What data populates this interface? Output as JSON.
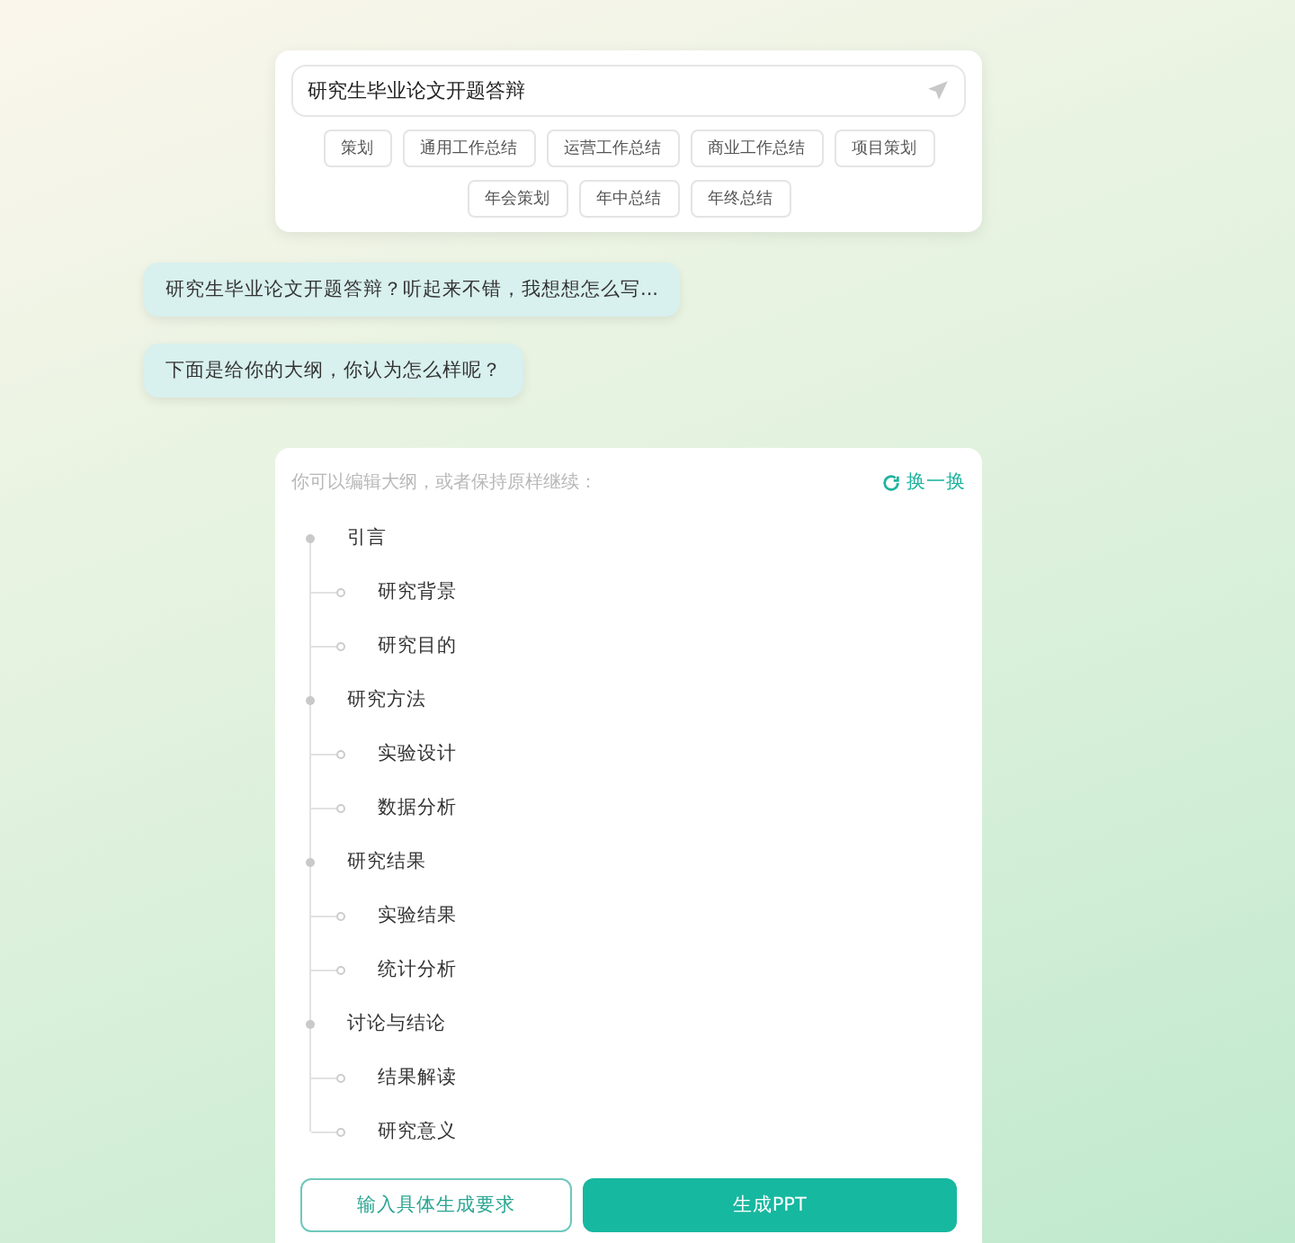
{
  "search": {
    "value": "研究生毕业论文开题答辩"
  },
  "chips": [
    [
      "策划",
      "通用工作总结",
      "运营工作总结",
      "商业工作总结",
      "项目策划"
    ],
    [
      "年会策划",
      "年中总结",
      "年终总结"
    ]
  ],
  "messages": [
    "研究生毕业论文开题答辩？听起来不错，我想想怎么写...",
    "下面是给你的大纲，你认为怎么样呢？"
  ],
  "outline": {
    "hint": "你可以编辑大纲，或者保持原样继续：",
    "refresh": "换一换",
    "items": [
      {
        "label": "引言",
        "children": [
          {
            "label": "研究背景"
          },
          {
            "label": "研究目的"
          }
        ]
      },
      {
        "label": "研究方法",
        "children": [
          {
            "label": "实验设计"
          },
          {
            "label": "数据分析"
          }
        ]
      },
      {
        "label": "研究结果",
        "children": [
          {
            "label": "实验结果"
          },
          {
            "label": "统计分析"
          }
        ]
      },
      {
        "label": "讨论与结论",
        "children": [
          {
            "label": "结果解读"
          },
          {
            "label": "研究意义"
          }
        ]
      }
    ]
  },
  "buttons": [
    {
      "kind": "outline",
      "label": "输入具体生成要求"
    },
    {
      "kind": "primary",
      "label": "生成PPT"
    }
  ]
}
